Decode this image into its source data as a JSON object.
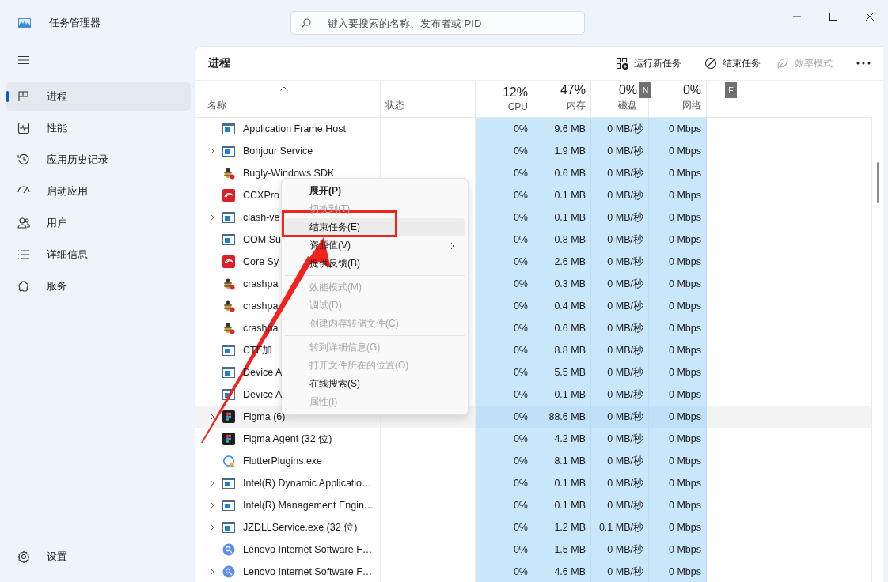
{
  "window": {
    "title": "任务管理器"
  },
  "search": {
    "placeholder": "键入要搜索的名称、发布者或 PID"
  },
  "sidebar": {
    "items": [
      {
        "label": "进程",
        "selected": true
      },
      {
        "label": "性能",
        "selected": false
      },
      {
        "label": "应用历史记录",
        "selected": false
      },
      {
        "label": "启动应用",
        "selected": false
      },
      {
        "label": "用户",
        "selected": false
      },
      {
        "label": "详细信息",
        "selected": false
      },
      {
        "label": "服务",
        "selected": false
      }
    ],
    "footer": "设置"
  },
  "page_title": "进程",
  "toolbar": [
    {
      "label": "运行新任务",
      "disabled": false
    },
    {
      "label": "结束任务",
      "disabled": false
    },
    {
      "label": "效率模式",
      "disabled": true
    }
  ],
  "key_tips": [
    "N",
    "E"
  ],
  "columns": [
    {
      "label": "名称"
    },
    {
      "label": "状态"
    },
    {
      "label": "CPU",
      "total": "12%"
    },
    {
      "label": "内存",
      "total": "47%"
    },
    {
      "label": "磁盘",
      "total": "0%"
    },
    {
      "label": "网络",
      "total": "0%"
    }
  ],
  "rows": [
    {
      "name": "Application Frame Host",
      "kind": "app",
      "expandable": false,
      "hovered": false,
      "cpu": "0%",
      "memory": "9.6 MB",
      "disk": "0 MB/秒",
      "network": "0 Mbps"
    },
    {
      "name": "Bonjour Service",
      "kind": "app",
      "expandable": true,
      "hovered": false,
      "cpu": "0%",
      "memory": "1.9 MB",
      "disk": "0 MB/秒",
      "network": "0 Mbps"
    },
    {
      "name": "Bugly-Windows SDK",
      "kind": "bug",
      "expandable": false,
      "hovered": false,
      "cpu": "0%",
      "memory": "0.6 MB",
      "disk": "0 MB/秒",
      "network": "0 Mbps"
    },
    {
      "name": "CCXPro",
      "kind": "swirl",
      "expandable": false,
      "hovered": false,
      "cpu": "0%",
      "memory": "0.1 MB",
      "disk": "0 MB/秒",
      "network": "0 Mbps"
    },
    {
      "name": "clash-ve",
      "kind": "app",
      "expandable": true,
      "hovered": false,
      "cpu": "0%",
      "memory": "0.1 MB",
      "disk": "0 MB/秒",
      "network": "0 Mbps"
    },
    {
      "name": "COM Su",
      "kind": "app",
      "expandable": false,
      "hovered": false,
      "cpu": "0%",
      "memory": "0.8 MB",
      "disk": "0 MB/秒",
      "network": "0 Mbps"
    },
    {
      "name": "Core Sy",
      "kind": "swirl",
      "expandable": false,
      "hovered": false,
      "cpu": "0%",
      "memory": "2.6 MB",
      "disk": "0 MB/秒",
      "network": "0 Mbps"
    },
    {
      "name": "crashpa",
      "kind": "bug",
      "expandable": false,
      "hovered": false,
      "cpu": "0%",
      "memory": "0.3 MB",
      "disk": "0 MB/秒",
      "network": "0 Mbps"
    },
    {
      "name": "crashpa",
      "kind": "bug",
      "expandable": false,
      "hovered": false,
      "cpu": "0%",
      "memory": "0.4 MB",
      "disk": "0 MB/秒",
      "network": "0 Mbps"
    },
    {
      "name": "crashpa",
      "kind": "bug",
      "expandable": false,
      "hovered": false,
      "cpu": "0%",
      "memory": "0.6 MB",
      "disk": "0 MB/秒",
      "network": "0 Mbps"
    },
    {
      "name": "CTF加",
      "kind": "app",
      "expandable": false,
      "hovered": false,
      "cpu": "0%",
      "memory": "8.8 MB",
      "disk": "0 MB/秒",
      "network": "0 Mbps"
    },
    {
      "name": "Device A",
      "kind": "app",
      "expandable": false,
      "hovered": false,
      "cpu": "0%",
      "memory": "5.5 MB",
      "disk": "0 MB/秒",
      "network": "0 Mbps"
    },
    {
      "name": "Device A",
      "kind": "app",
      "expandable": false,
      "hovered": false,
      "cpu": "0%",
      "memory": "0.1 MB",
      "disk": "0 MB/秒",
      "network": "0 Mbps"
    },
    {
      "name": "Figma (6)",
      "kind": "figma",
      "expandable": true,
      "hovered": true,
      "cpu": "0%",
      "memory": "88.6 MB",
      "disk": "0 MB/秒",
      "network": "0 Mbps"
    },
    {
      "name": "Figma Agent (32 位)",
      "kind": "figma",
      "expandable": false,
      "hovered": false,
      "cpu": "0%",
      "memory": "4.2 MB",
      "disk": "0 MB/秒",
      "network": "0 Mbps"
    },
    {
      "name": "FlutterPlugins.exe",
      "kind": "bubble",
      "expandable": false,
      "hovered": false,
      "cpu": "0%",
      "memory": "8.1 MB",
      "disk": "0 MB/秒",
      "network": "0 Mbps"
    },
    {
      "name": "Intel(R) Dynamic Applicatio…",
      "kind": "app",
      "expandable": true,
      "hovered": false,
      "cpu": "0%",
      "memory": "0.1 MB",
      "disk": "0 MB/秒",
      "network": "0 Mbps"
    },
    {
      "name": "Intel(R) Management Engin…",
      "kind": "app",
      "expandable": true,
      "hovered": false,
      "cpu": "0%",
      "memory": "0.1 MB",
      "disk": "0 MB/秒",
      "network": "0 Mbps"
    },
    {
      "name": "JZDLLService.exe (32 位)",
      "kind": "app",
      "expandable": true,
      "hovered": false,
      "cpu": "0%",
      "memory": "1.2 MB",
      "disk": "0.1 MB/秒",
      "network": "0 Mbps"
    },
    {
      "name": "Lenovo Internet Software F…",
      "kind": "globe",
      "expandable": false,
      "hovered": false,
      "cpu": "0%",
      "memory": "1.5 MB",
      "disk": "0 MB/秒",
      "network": "0 Mbps"
    },
    {
      "name": "Lenovo Internet Software F…",
      "kind": "globe",
      "expandable": true,
      "hovered": false,
      "cpu": "0%",
      "memory": "4.6 MB",
      "disk": "0 MB/秒",
      "network": "0 Mbps"
    }
  ],
  "context_menu": [
    {
      "kind": "item",
      "label": "展开(P)",
      "default": true,
      "disabled": false,
      "hovered": false,
      "submenu": false
    },
    {
      "kind": "item",
      "label": "切换到(T)",
      "default": false,
      "disabled": true,
      "hovered": false,
      "submenu": false
    },
    {
      "kind": "item",
      "label": "结束任务(E)",
      "default": false,
      "disabled": false,
      "hovered": true,
      "submenu": false
    },
    {
      "kind": "item",
      "label": "资源值(V)",
      "default": false,
      "disabled": false,
      "hovered": false,
      "submenu": true
    },
    {
      "kind": "item",
      "label": "提供反馈(B)",
      "default": false,
      "disabled": false,
      "hovered": false,
      "submenu": false
    },
    {
      "kind": "separator"
    },
    {
      "kind": "item",
      "label": "效能模式(M)",
      "default": false,
      "disabled": true,
      "hovered": false,
      "submenu": false
    },
    {
      "kind": "item",
      "label": "调试(D)",
      "default": false,
      "disabled": true,
      "hovered": false,
      "submenu": false
    },
    {
      "kind": "item",
      "label": "创建内存转储文件(C)",
      "default": false,
      "disabled": true,
      "hovered": false,
      "submenu": false
    },
    {
      "kind": "separator"
    },
    {
      "kind": "item",
      "label": "转到详细信息(G)",
      "default": false,
      "disabled": true,
      "hovered": false,
      "submenu": false
    },
    {
      "kind": "item",
      "label": "打开文件所在的位置(O)",
      "default": false,
      "disabled": true,
      "hovered": false,
      "submenu": false
    },
    {
      "kind": "item",
      "label": "在线搜索(S)",
      "default": false,
      "disabled": false,
      "hovered": false,
      "submenu": false
    },
    {
      "kind": "item",
      "label": "属性(I)",
      "default": false,
      "disabled": true,
      "hovered": false,
      "submenu": false
    }
  ]
}
